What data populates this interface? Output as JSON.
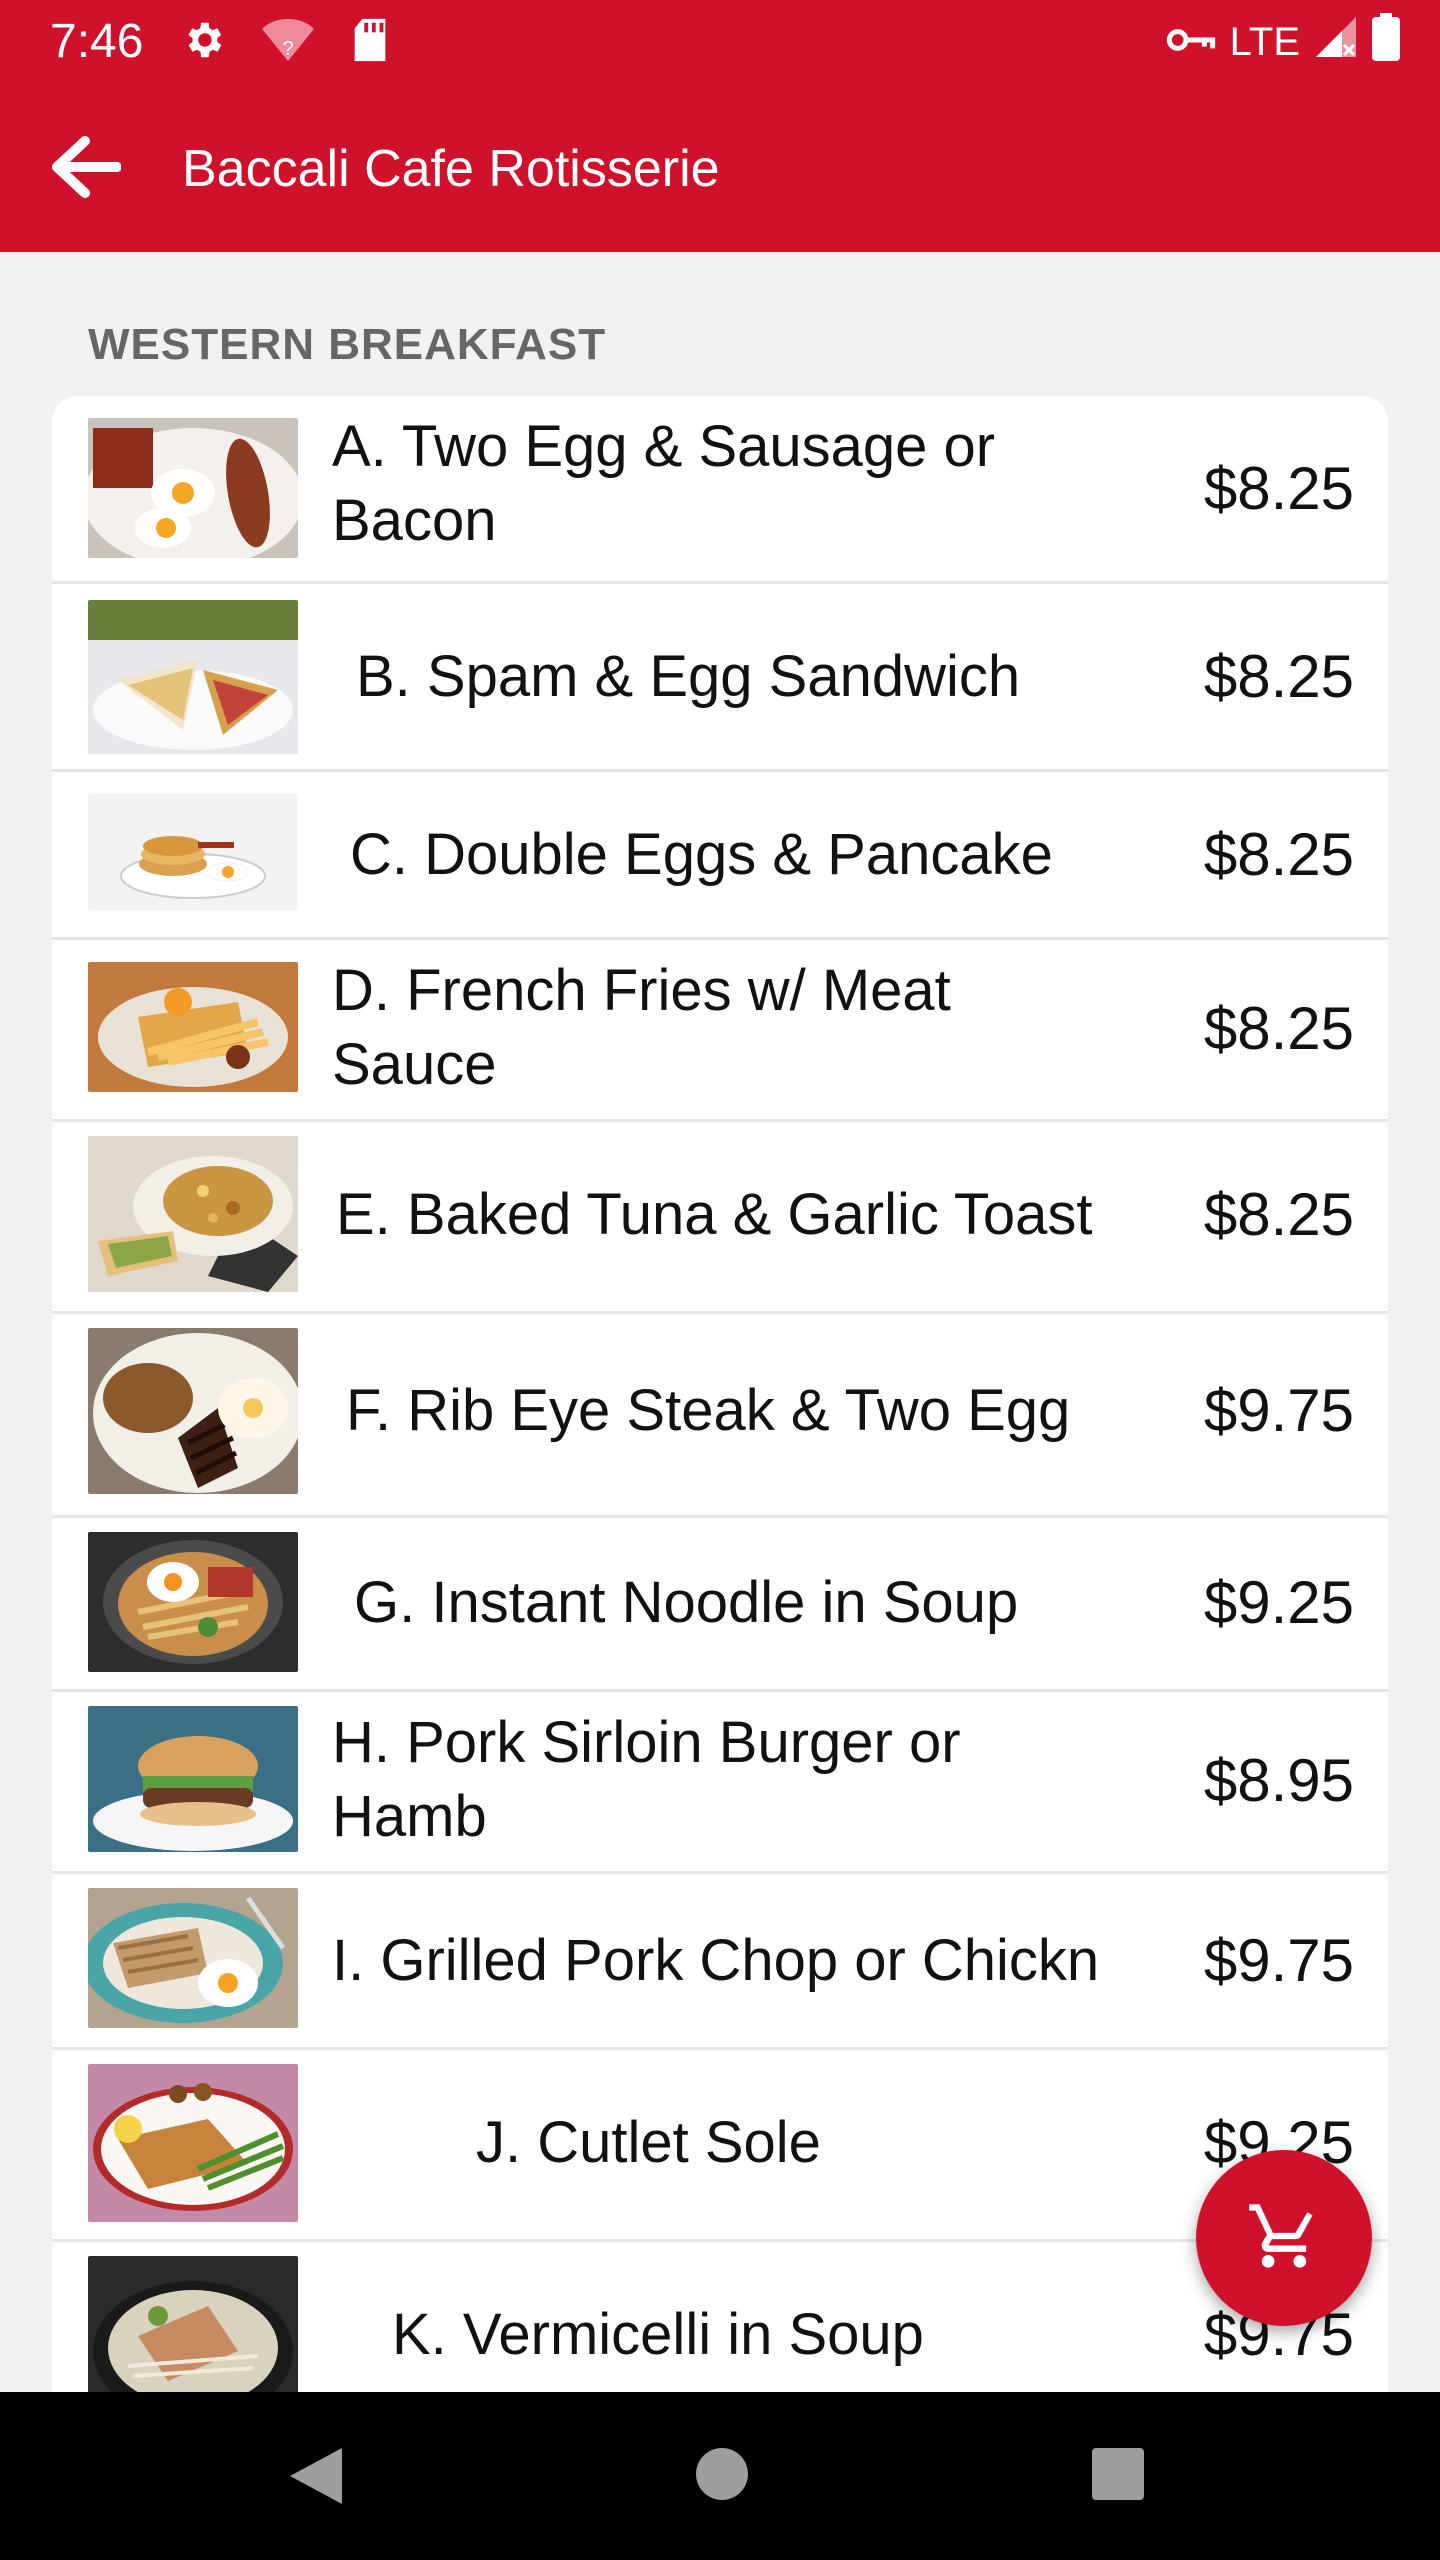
{
  "status_bar": {
    "time": "7:46",
    "network": "LTE",
    "icons": [
      "settings-icon",
      "wifi-question-icon",
      "sd-card-icon",
      "vpn-key-icon",
      "signal-icon",
      "battery-icon"
    ]
  },
  "app_bar": {
    "title": "Baccali Cafe Rotisserie",
    "back_icon": "arrow-left-icon"
  },
  "section": {
    "title": "WESTERN BREAKFAST"
  },
  "items": [
    {
      "name": "A. Two Egg & Sausage or Bacon",
      "price": "$8.25"
    },
    {
      "name": "B. Spam & Egg Sandwich",
      "price": "$8.25"
    },
    {
      "name": "C. Double Eggs & Pancake",
      "price": "$8.25"
    },
    {
      "name": "D. French Fries w/ Meat Sauce",
      "price": "$8.25"
    },
    {
      "name": "E. Baked Tuna & Garlic Toast",
      "price": "$8.25"
    },
    {
      "name": "F. Rib Eye Steak & Two Egg",
      "price": "$9.75"
    },
    {
      "name": "G. Instant Noodle in Soup",
      "price": "$9.25"
    },
    {
      "name": "H. Pork Sirloin Burger or Hamb",
      "price": "$8.95"
    },
    {
      "name": "I. Grilled Pork Chop or Chickn",
      "price": "$9.75"
    },
    {
      "name": "J. Cutlet Sole",
      "price": "$9.25"
    },
    {
      "name": "K. Vermicelli in Soup",
      "price": "$9.75"
    }
  ],
  "fab": {
    "icon": "cart-icon"
  },
  "nav_bar": {
    "icons": [
      "back-triangle-icon",
      "home-circle-icon",
      "recents-square-icon"
    ]
  },
  "colors": {
    "primary": "#d0112b",
    "background": "#f1f1f1",
    "card": "#ffffff",
    "section_text": "#666666"
  }
}
